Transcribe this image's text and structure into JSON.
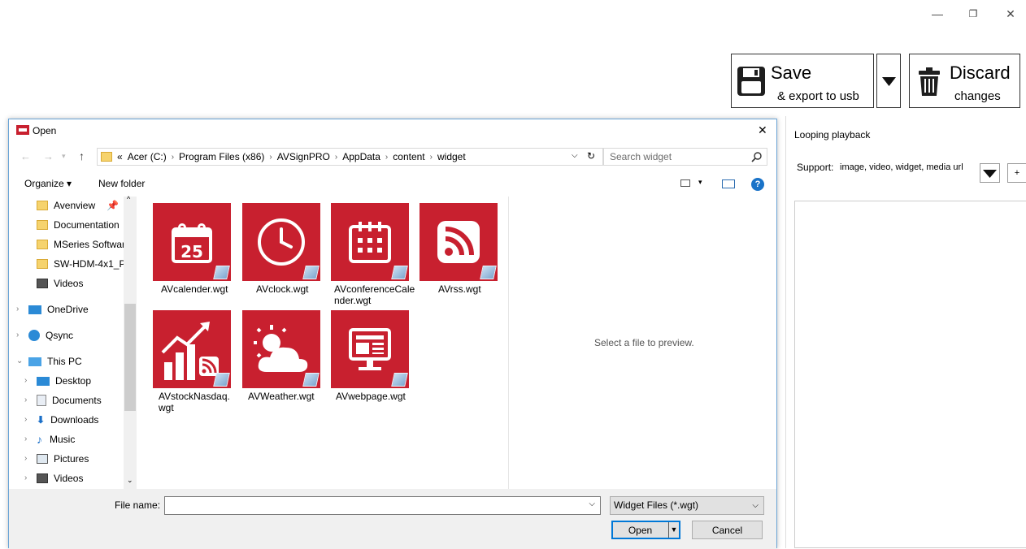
{
  "window_controls": {
    "minimize": "—",
    "restore": "❐",
    "close": "✕"
  },
  "toolbar": {
    "save_title": "Save",
    "save_subtitle": "& export to usb",
    "discard_title": "Discard",
    "discard_subtitle": "changes"
  },
  "right_panel": {
    "title": "Looping playback",
    "support_label": "Support:",
    "support_value": "image, video, widget, media url",
    "add_label": "+"
  },
  "dialog": {
    "title": "Open",
    "close": "✕",
    "breadcrumb": [
      "«",
      "Acer (C:)",
      "Program Files (x86)",
      "AVSignPRO",
      "AppData",
      "content",
      "widget"
    ],
    "search_placeholder": "Search widget",
    "organize": "Organize ▾",
    "new_folder": "New folder",
    "nav": [
      {
        "label": "Avenview",
        "icon": "download-folder-icon"
      },
      {
        "label": "Documentation",
        "icon": "folder-icon"
      },
      {
        "label": "MSeries Softwar",
        "icon": "folder-icon"
      },
      {
        "label": "SW-HDM-4x1_P",
        "icon": "folder-icon"
      },
      {
        "label": "Videos",
        "icon": "video-folder-icon"
      },
      {
        "label": "OneDrive",
        "icon": "cloud-icon"
      },
      {
        "label": "Qsync",
        "icon": "sync-icon"
      },
      {
        "label": "This PC",
        "icon": "computer-icon"
      },
      {
        "label": "Desktop",
        "icon": "desktop-icon"
      },
      {
        "label": "Documents",
        "icon": "documents-icon"
      },
      {
        "label": "Downloads",
        "icon": "downloads-icon"
      },
      {
        "label": "Music",
        "icon": "music-icon"
      },
      {
        "label": "Pictures",
        "icon": "pictures-icon"
      },
      {
        "label": "Videos",
        "icon": "video-folder-icon"
      }
    ],
    "files": [
      {
        "name": "AVcalender.wgt",
        "icon": "calendar-icon",
        "day": "25"
      },
      {
        "name": "AVclock.wgt",
        "icon": "clock-icon"
      },
      {
        "name": "AVconferenceCalender.wgt",
        "icon": "conference-calendar-icon"
      },
      {
        "name": "AVrss.wgt",
        "icon": "rss-icon"
      },
      {
        "name": "AVstockNasdaq.wgt",
        "icon": "stock-chart-icon"
      },
      {
        "name": "AVWeather.wgt",
        "icon": "weather-icon"
      },
      {
        "name": "AVwebpage.wgt",
        "icon": "webpage-icon"
      }
    ],
    "preview_text": "Select a file to preview.",
    "file_name_label": "File name:",
    "file_name_value": "",
    "file_type": "Widget Files  (*.wgt)",
    "open_label": "Open",
    "cancel_label": "Cancel"
  }
}
